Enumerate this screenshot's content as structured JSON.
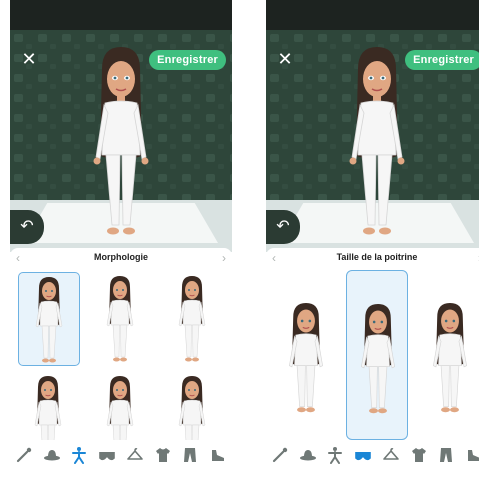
{
  "colors": {
    "accent": "#3fbf7f",
    "selected_blue": "#1a86d6",
    "selected_bg": "#e8f3fb",
    "icon_gray": "#6f7876",
    "stage_green": "#2e463a"
  },
  "screens": [
    {
      "close_icon": "close-icon",
      "save_label": "Enregistrer",
      "undo_icon": "undo-icon",
      "category_title": "Morphologie",
      "prev_icon": "chevron-left-icon",
      "next_icon": "chevron-right-icon",
      "selected_option_index": 0,
      "toolbar_selected_index": 2
    },
    {
      "close_icon": "close-icon",
      "save_label": "Enregistrer",
      "undo_icon": "undo-icon",
      "category_title": "Taille de la poitrine",
      "prev_icon": "chevron-left-icon",
      "next_icon": "chevron-right-icon",
      "selected_option_index": 1,
      "toolbar_selected_index": 3
    }
  ],
  "toolbar_icons": [
    "brush-icon",
    "hat-icon",
    "body-icon",
    "bra-icon",
    "hanger-icon",
    "tshirt-icon",
    "pants-icon",
    "shoe-icon"
  ]
}
